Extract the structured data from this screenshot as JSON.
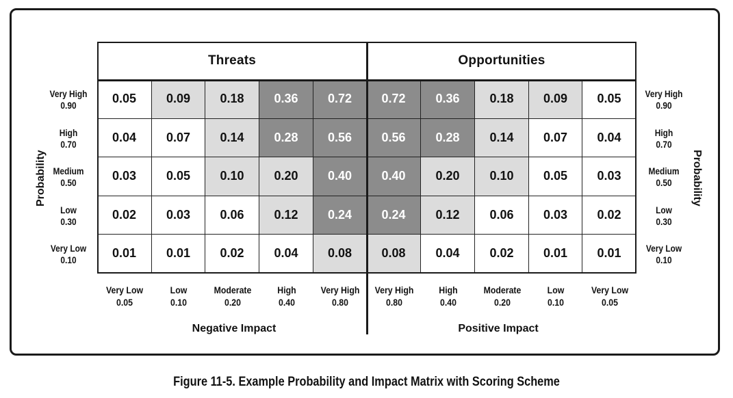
{
  "chart_data": {
    "type": "heatmap",
    "title": "Figure 11-5. Example Probability and Impact Matrix with Scoring Scheme",
    "sections": [
      {
        "name": "Threats",
        "xlabel": "Negative Impact"
      },
      {
        "name": "Opportunities",
        "xlabel": "Positive Impact"
      }
    ],
    "ylabel": "Probability",
    "row_labels": [
      {
        "name": "Very High",
        "value": "0.90"
      },
      {
        "name": "High",
        "value": "0.70"
      },
      {
        "name": "Medium",
        "value": "0.50"
      },
      {
        "name": "Low",
        "value": "0.30"
      },
      {
        "name": "Very Low",
        "value": "0.10"
      }
    ],
    "column_labels": [
      {
        "name": "Very Low",
        "value": "0.05"
      },
      {
        "name": "Low",
        "value": "0.10"
      },
      {
        "name": "Moderate",
        "value": "0.20"
      },
      {
        "name": "High",
        "value": "0.40"
      },
      {
        "name": "Very High",
        "value": "0.80"
      },
      {
        "name": "Very High",
        "value": "0.80"
      },
      {
        "name": "High",
        "value": "0.40"
      },
      {
        "name": "Moderate",
        "value": "0.20"
      },
      {
        "name": "Low",
        "value": "0.10"
      },
      {
        "name": "Very Low",
        "value": "0.05"
      }
    ],
    "values": [
      [
        "0.05",
        "0.09",
        "0.18",
        "0.36",
        "0.72",
        "0.72",
        "0.36",
        "0.18",
        "0.09",
        "0.05"
      ],
      [
        "0.04",
        "0.07",
        "0.14",
        "0.28",
        "0.56",
        "0.56",
        "0.28",
        "0.14",
        "0.07",
        "0.04"
      ],
      [
        "0.03",
        "0.05",
        "0.10",
        "0.20",
        "0.40",
        "0.40",
        "0.20",
        "0.10",
        "0.05",
        "0.03"
      ],
      [
        "0.02",
        "0.03",
        "0.06",
        "0.12",
        "0.24",
        "0.24",
        "0.12",
        "0.06",
        "0.03",
        "0.02"
      ],
      [
        "0.01",
        "0.01",
        "0.02",
        "0.04",
        "0.08",
        "0.08",
        "0.04",
        "0.02",
        "0.01",
        "0.01"
      ]
    ],
    "zones": [
      [
        "low",
        "medium",
        "medium",
        "high",
        "high",
        "high",
        "high",
        "medium",
        "medium",
        "low"
      ],
      [
        "low",
        "low",
        "medium",
        "high",
        "high",
        "high",
        "high",
        "medium",
        "low",
        "low"
      ],
      [
        "low",
        "low",
        "medium",
        "medium",
        "high",
        "high",
        "medium",
        "medium",
        "low",
        "low"
      ],
      [
        "low",
        "low",
        "low",
        "medium",
        "high",
        "high",
        "medium",
        "low",
        "low",
        "low"
      ],
      [
        "low",
        "low",
        "low",
        "low",
        "medium",
        "medium",
        "low",
        "low",
        "low",
        "low"
      ]
    ],
    "zone_colors": {
      "low": "#ffffff",
      "medium": "#dcdcdc",
      "high": "#8c8c8c"
    },
    "zone_text_colors": {
      "low": "#111111",
      "medium": "#111111",
      "high": "#ffffff"
    }
  }
}
